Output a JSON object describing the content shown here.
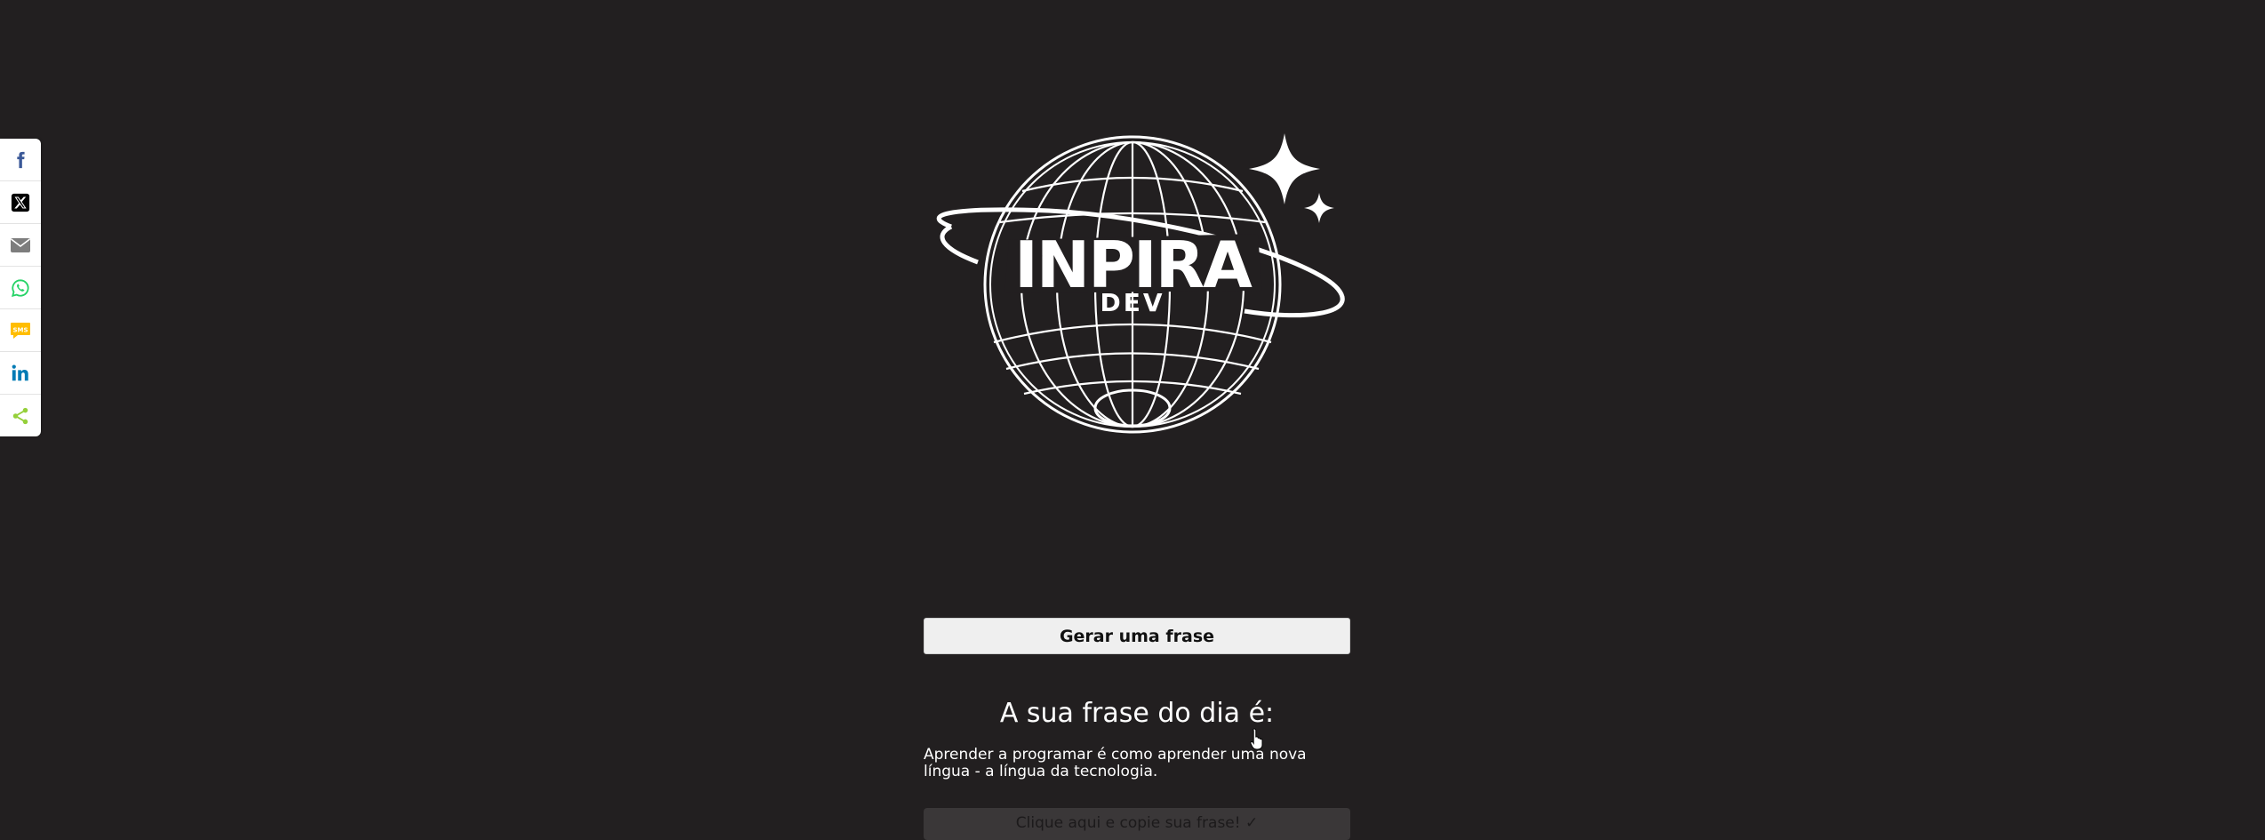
{
  "share": {
    "items": [
      {
        "name": "share-facebook",
        "icon": "facebook-icon",
        "color": "#3b5998"
      },
      {
        "name": "share-x",
        "icon": "x-twitter-icon",
        "color": "#000000"
      },
      {
        "name": "share-email",
        "icon": "email-icon",
        "color": "#7d7d7d"
      },
      {
        "name": "share-whatsapp",
        "icon": "whatsapp-icon",
        "color": "#25d366"
      },
      {
        "name": "share-sms",
        "icon": "sms-icon",
        "color": "#ffbd00"
      },
      {
        "name": "share-linkedin",
        "icon": "linkedin-icon",
        "color": "#007bb5"
      },
      {
        "name": "share-more",
        "icon": "share-icon",
        "color": "#95d03a"
      }
    ]
  },
  "logo": {
    "word": "INPIRA",
    "sub": "DEV"
  },
  "main": {
    "generate_label": "Gerar uma frase",
    "phrase_title": "A sua frase do dia é:",
    "phrase_text": "Aprender a programar é como aprender uma nova língua - a língua da tecnologia.",
    "copy_label": "Clique aqui e copie sua frase! ✓"
  },
  "colors": {
    "background": "#221f20",
    "button": "#efefef"
  }
}
